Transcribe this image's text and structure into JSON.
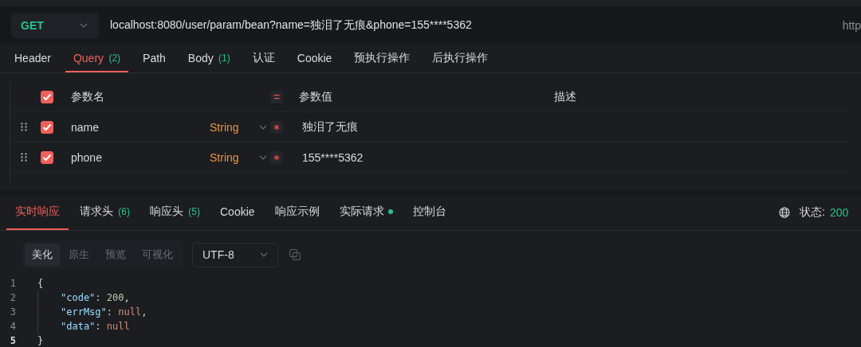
{
  "request": {
    "method": "GET",
    "url": "localhost:8080/user/param/bean?name=独泪了无痕&phone=155****5362",
    "side_text": "http"
  },
  "request_tabs": [
    {
      "label": "Header",
      "selected": false
    },
    {
      "label": "Query",
      "count": "(2)",
      "selected": true
    },
    {
      "label": "Path",
      "selected": false
    },
    {
      "label": "Body",
      "count": "(1)",
      "selected": false
    },
    {
      "label": "认证",
      "selected": false
    },
    {
      "label": "Cookie",
      "selected": false
    },
    {
      "label": "预执行操作",
      "selected": false
    },
    {
      "label": "后执行操作",
      "selected": false
    }
  ],
  "params": {
    "all_checked": true,
    "columns": {
      "name": "参数名",
      "equals": "=",
      "value": "参数值",
      "description": "描述"
    },
    "rows": [
      {
        "checked": true,
        "name": "name",
        "type": "String",
        "required": true,
        "value": "独泪了无痕"
      },
      {
        "checked": true,
        "name": "phone",
        "type": "String",
        "required": true,
        "value": "155****5362"
      }
    ]
  },
  "response_tabs": [
    {
      "label": "实时响应",
      "dot": false,
      "selected": true
    },
    {
      "label": "请求头",
      "count": "(6)",
      "dot": false,
      "selected": false
    },
    {
      "label": "响应头",
      "count": "(5)",
      "dot": false,
      "selected": false
    },
    {
      "label": "Cookie",
      "dot": false,
      "selected": false
    },
    {
      "label": "响应示例",
      "dot": false,
      "selected": false
    },
    {
      "label": "实际请求",
      "dot": true,
      "selected": false
    },
    {
      "label": "控制台",
      "dot": false,
      "selected": false
    }
  ],
  "status": {
    "label": "状态:",
    "code": "200"
  },
  "view_modes": [
    {
      "label": "美化",
      "selected": true
    },
    {
      "label": "原生",
      "selected": false
    },
    {
      "label": "预览",
      "selected": false
    },
    {
      "label": "可视化",
      "selected": false
    }
  ],
  "encoding": "UTF-8",
  "code_lines": [
    {
      "number": "1",
      "current": false,
      "indent": false,
      "tokens": [
        {
          "kind": "punct",
          "text": "{"
        }
      ]
    },
    {
      "number": "2",
      "current": false,
      "indent": true,
      "tokens": [
        {
          "kind": "key",
          "text": "\"code\""
        },
        {
          "kind": "punct",
          "text": ": "
        },
        {
          "kind": "number",
          "text": "200"
        },
        {
          "kind": "punct",
          "text": ","
        }
      ]
    },
    {
      "number": "3",
      "current": false,
      "indent": true,
      "tokens": [
        {
          "kind": "key",
          "text": "\"errMsg\""
        },
        {
          "kind": "punct",
          "text": ": "
        },
        {
          "kind": "null",
          "text": "null"
        },
        {
          "kind": "punct",
          "text": ","
        }
      ]
    },
    {
      "number": "4",
      "current": false,
      "indent": true,
      "tokens": [
        {
          "kind": "key",
          "text": "\"data\""
        },
        {
          "kind": "punct",
          "text": ": "
        },
        {
          "kind": "null",
          "text": "null"
        }
      ]
    },
    {
      "number": "5",
      "current": true,
      "indent": false,
      "tokens": [
        {
          "kind": "punct",
          "text": "}"
        }
      ]
    }
  ]
}
